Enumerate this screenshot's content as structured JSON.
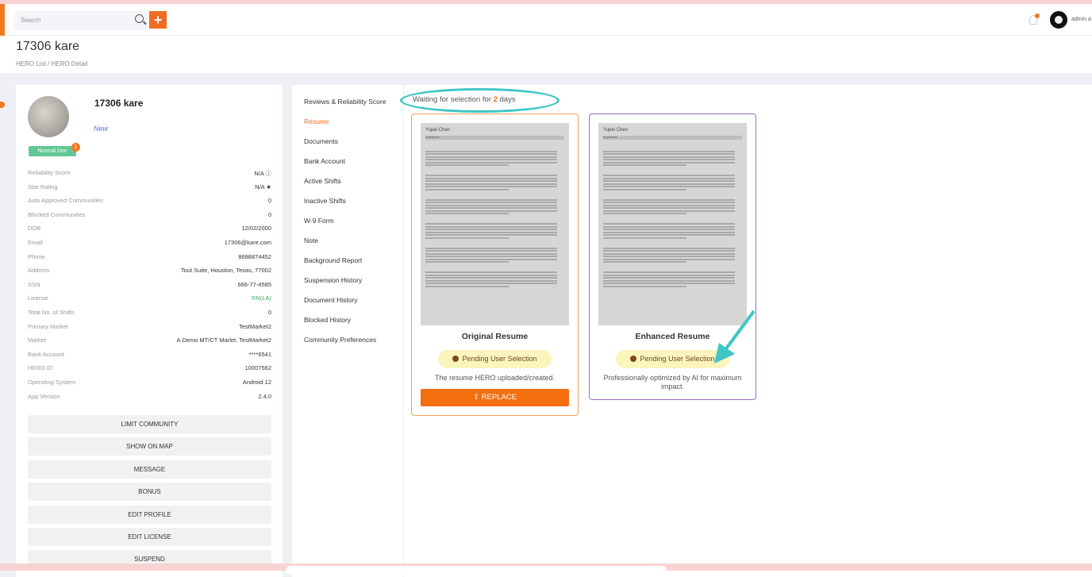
{
  "header": {
    "search_placeholder": "Search",
    "logo": "A+",
    "user": "admin a"
  },
  "page": {
    "title": "17306 kare",
    "breadcrumb": "HERO List / HERO Detail"
  },
  "profile": {
    "name": "17306 kare",
    "status": "New",
    "doc_badge": "Normal Doc",
    "doc_count": "1",
    "fields": [
      {
        "label": "Reliability Score",
        "value": "N/A ⓘ"
      },
      {
        "label": "Star Rating",
        "value": "N/A ★"
      },
      {
        "label": "Auto Approved Communities",
        "value": "0"
      },
      {
        "label": "Blocked Communities",
        "value": "0"
      },
      {
        "label": "DOB",
        "value": "12/02/2000"
      },
      {
        "label": "Email",
        "value": "17306@kare.com"
      },
      {
        "label": "Phone",
        "value": "8688874452"
      },
      {
        "label": "Address",
        "value": "Tout Suite, Houston, Texas, 77002"
      },
      {
        "label": "SSN",
        "value": "666-77-4585"
      },
      {
        "label": "License",
        "value": "RN(LA)"
      },
      {
        "label": "Total No. of Shifts",
        "value": "0"
      },
      {
        "label": "Primary Market",
        "value": "TestMarket2"
      },
      {
        "label": "Market",
        "value": "A Demo MT/CT Marlet, TestMarket2"
      },
      {
        "label": "Bank Account",
        "value": "****6541"
      },
      {
        "label": "HERO ID",
        "value": "10007562"
      },
      {
        "label": "Operating System",
        "value": "Android 12"
      },
      {
        "label": "App Version",
        "value": "2.4.0"
      }
    ],
    "actions": [
      "LIMIT COMMUNITY",
      "SHOW ON MAP",
      "MESSAGE",
      "BONUS",
      "EDIT PROFILE",
      "EDIT LICENSE",
      "SUSPEND"
    ]
  },
  "nav": {
    "active": "Resume",
    "items": [
      "Reviews & Reliability Score",
      "Resume",
      "Documents",
      "Bank Account",
      "Active Shifts",
      "Inactive Shifts",
      "W-9 Form",
      "Note",
      "Background Report",
      "Suspension History",
      "Document History",
      "Blocked History",
      "Community Preferences"
    ]
  },
  "resume": {
    "waiting_prefix": "Waiting for selection for ",
    "waiting_days": "2",
    "waiting_suffix": " days",
    "preview_name": "Yupei Chen",
    "preview_section": "Experience",
    "original": {
      "title": "Original Resume",
      "status": "Pending User Selection",
      "description": "The resume HERO uploaded/created.",
      "button": "REPLACE"
    },
    "enhanced": {
      "title": "Enhanced Resume",
      "status": "Pending User Selection",
      "description": "Professionally optimized by AI for maximum impact."
    }
  },
  "colors": {
    "accent": "#ef6c23",
    "annotation": "#3fc6c6",
    "enhanced_border": "#9a6fc0"
  }
}
